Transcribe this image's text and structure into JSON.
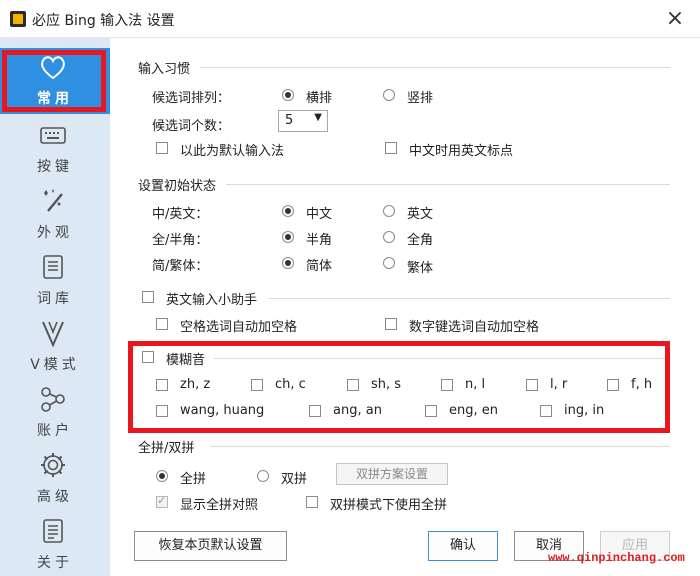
{
  "window": {
    "title": "必应 Bing 输入法 设置",
    "close": "×"
  },
  "sidebar": {
    "items": [
      {
        "label": "常用",
        "icon": "heart-icon"
      },
      {
        "label": "按键",
        "icon": "keyboard-icon"
      },
      {
        "label": "外观",
        "icon": "brush-sparkle-icon"
      },
      {
        "label": "词库",
        "icon": "book-list-icon"
      },
      {
        "label": "V模式",
        "icon": "v-mode-icon"
      },
      {
        "label": "账户",
        "icon": "share-nodes-icon"
      },
      {
        "label": "高级",
        "icon": "gear-icon"
      },
      {
        "label": "关于",
        "icon": "document-icon"
      }
    ]
  },
  "habits": {
    "title": "输入习惯",
    "candidate_order_label": "候选词排列：",
    "order_horizontal": "横排",
    "order_vertical": "竖排",
    "candidate_count_label": "候选词个数：",
    "candidate_count_value": "5",
    "default_ime": "以此为默认输入法",
    "chinese_with_english_punct": "中文时用英文标点"
  },
  "initial_state": {
    "title": "设置初始状态",
    "cn_en_label": "中/英文：",
    "cn": "中文",
    "en": "英文",
    "width_label": "全/半角：",
    "half": "半角",
    "full": "全角",
    "script_label": "简/繁体：",
    "simplified": "简体",
    "traditional": "繁体"
  },
  "english_helper": {
    "title": "英文输入小助手",
    "space_select_add_space": "空格选词自动加空格",
    "digit_select_add_space": "数字键选词自动加空格"
  },
  "fuzzy": {
    "title": "模糊音",
    "pairs_row1": [
      "zh, z",
      "ch, c",
      "sh, s",
      "n, l",
      "l, r",
      "f, h"
    ],
    "pairs_row2": [
      "wang, huang",
      "ang, an",
      "eng, en",
      "ing, in"
    ]
  },
  "pinyin": {
    "title": "全拼/双拼",
    "full_pinyin": "全拼",
    "double_pinyin": "双拼",
    "double_scheme_button": "双拼方案设置",
    "show_full_pinyin_ref": "显示全拼对照",
    "use_full_in_double": "双拼模式下使用全拼"
  },
  "footer": {
    "restore_defaults": "恢复本页默认设置",
    "ok": "确认",
    "cancel": "取消",
    "apply": "应用"
  },
  "watermark": "www.qinpinchang.com",
  "colors": {
    "accent": "#2f8fe0",
    "sidebar_bg": "#dce8f3",
    "highlight": "#e8161f"
  }
}
